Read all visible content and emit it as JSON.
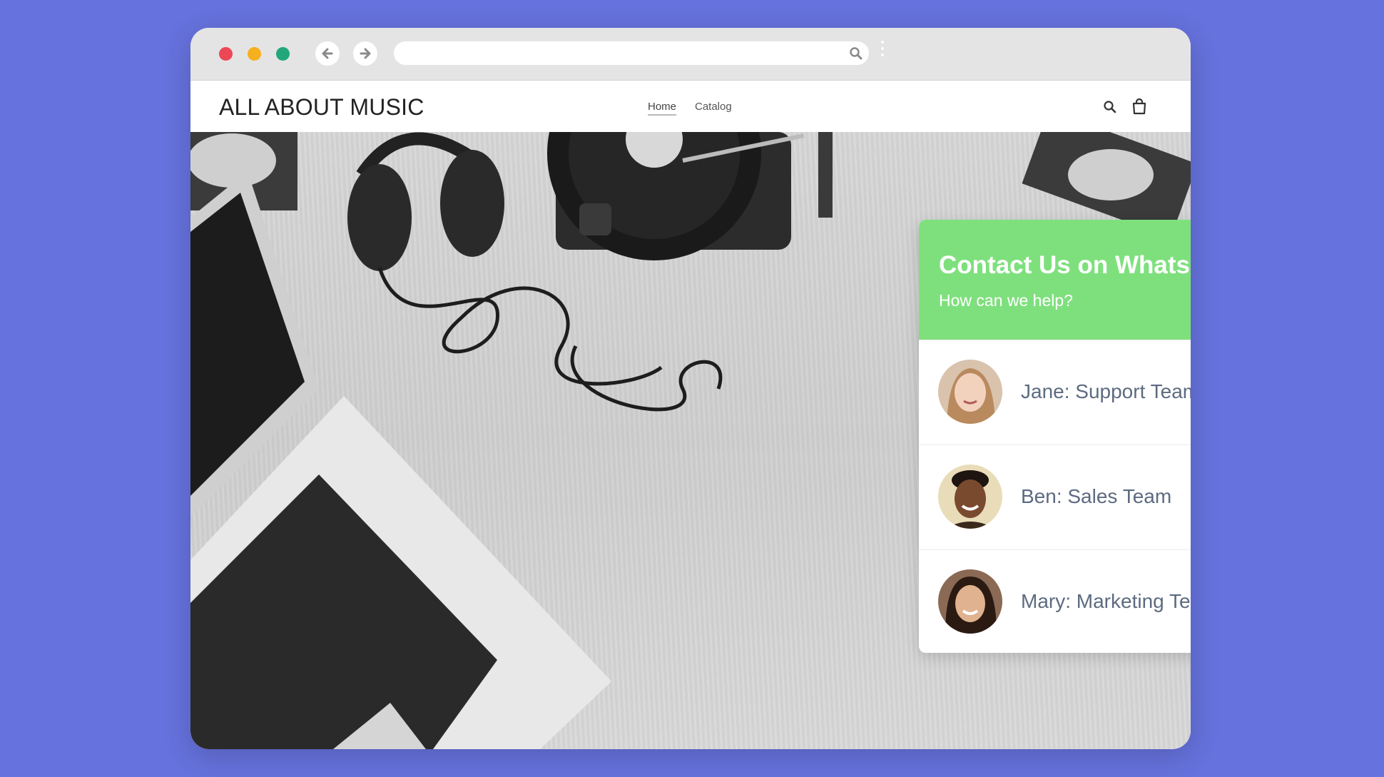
{
  "browser": {
    "back_icon": "arrow-left-icon",
    "forward_icon": "arrow-right-icon",
    "search_icon": "search-icon"
  },
  "site": {
    "logo": "ALL ABOUT MUSIC",
    "nav": [
      {
        "label": "Home",
        "active": true
      },
      {
        "label": "Catalog",
        "active": false
      }
    ],
    "icons": [
      "search-icon",
      "shopping-bag-icon"
    ]
  },
  "widget": {
    "title": "Contact Us on WhatsApp",
    "subtitle": "How can we help?",
    "accent_color": "#7EE07D",
    "agents": [
      {
        "name": "Jane: Support Team"
      },
      {
        "name": "Ben: Sales Team"
      },
      {
        "name": "Mary: Marketing Team"
      }
    ],
    "fab_icon": "whatsapp-icon"
  }
}
